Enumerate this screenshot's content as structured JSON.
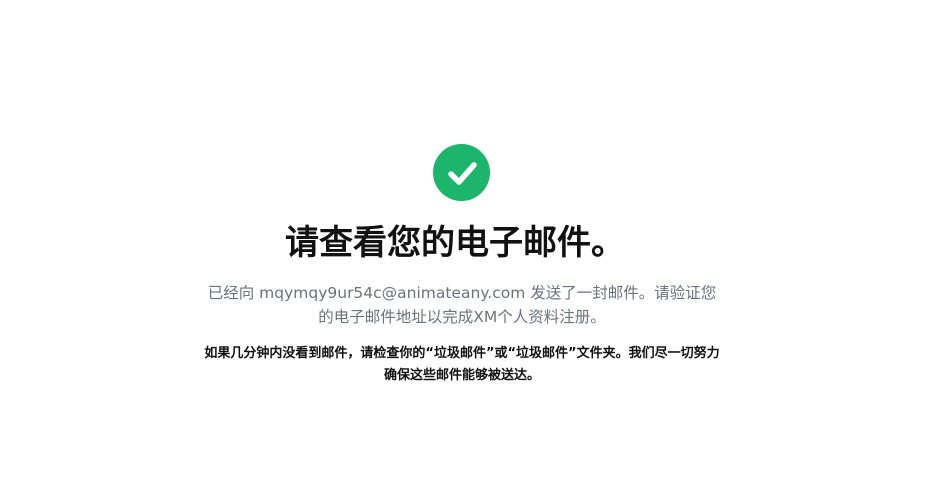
{
  "status": {
    "icon": "check-circle-icon",
    "color": "#1db56b"
  },
  "title": "请查看您的电子邮件。",
  "description": {
    "prefix": "已经向 ",
    "email": "mqymqy9ur54c@animateany.com",
    "suffix": " 发送了一封邮件。请验证您的电子邮件地址以完成XM个人资料注册。"
  },
  "note": "如果几分钟内没看到邮件，请检查你的“垃圾邮件”或“垃圾邮件”文件夹。我们尽一切努力确保这些邮件能够被送达。"
}
